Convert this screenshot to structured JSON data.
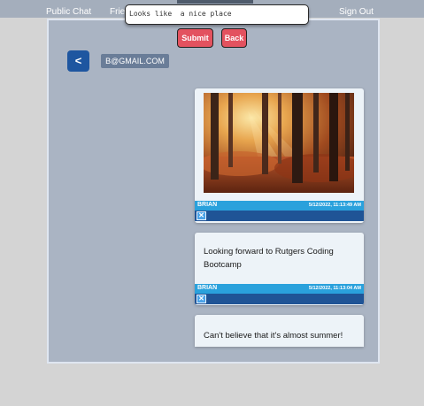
{
  "nav": {
    "public_chat": "Public Chat",
    "friends": "Frie",
    "sign_out": "Sign Out"
  },
  "popup": {
    "input_value": "Looks like  a nice place"
  },
  "actions": {
    "submit_label": "Submit",
    "back_label": "Back"
  },
  "header": {
    "back_arrow": "<",
    "email": "B@GMAIL.COM"
  },
  "messages": [
    {
      "type": "image",
      "image_description": "forest-sunlight-photo",
      "author": "BRIAN",
      "timestamp": "5/12/2022, 11:13:49 AM"
    },
    {
      "type": "text",
      "text": "Looking forward to Rutgers Coding Bootcamp",
      "author": "BRIAN",
      "timestamp": "5/12/2022, 11:13:04 AM"
    },
    {
      "type": "text",
      "text": "Can't believe that it's almost summer!"
    }
  ],
  "delete_glyph": "✕",
  "colors": {
    "accent_red": "#e3525f",
    "nav_blue": "#1e56a0",
    "meta_bar": "#2aa1dc",
    "delete_bar": "#1f5496"
  }
}
